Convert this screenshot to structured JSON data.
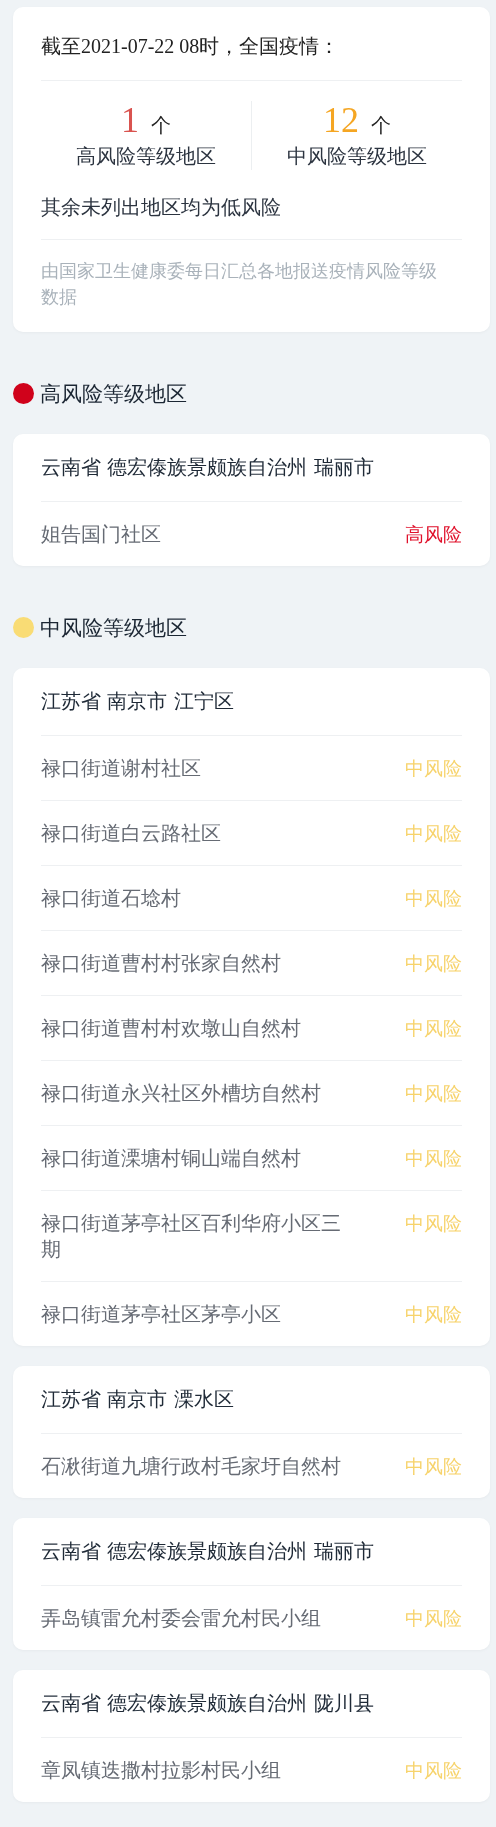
{
  "summary": {
    "title": "截至2021-07-22 08时，全国疫情：",
    "stats": [
      {
        "count": "1",
        "unit": "个",
        "label": "高风险等级地区",
        "kind": "high"
      },
      {
        "count": "12",
        "unit": "个",
        "label": "中风险等级地区",
        "kind": "medium"
      }
    ],
    "note": "其余未列出地区均为低风险",
    "source": "由国家卫生健康委每日汇总各地报送疫情风险等级数据"
  },
  "sections": [
    {
      "title": "高风险等级地区",
      "color": "#d0021b",
      "groups": [
        {
          "region": "云南省 德宏傣族景颇族自治州 瑞丽市",
          "items": [
            {
              "name": "姐告国门社区",
              "kind": "high",
              "risk_label": "高风险"
            }
          ]
        }
      ]
    },
    {
      "title": "中风险等级地区",
      "color": "#f9dc75",
      "groups": [
        {
          "region": "江苏省 南京市 江宁区",
          "items": [
            {
              "name": "禄口街道谢村社区",
              "kind": "medium",
              "risk_label": "中风险"
            },
            {
              "name": "禄口街道白云路社区",
              "kind": "medium",
              "risk_label": "中风险"
            },
            {
              "name": "禄口街道石埝村",
              "kind": "medium",
              "risk_label": "中风险"
            },
            {
              "name": "禄口街道曹村村张家自然村",
              "kind": "medium",
              "risk_label": "中风险"
            },
            {
              "name": "禄口街道曹村村欢墩山自然村",
              "kind": "medium",
              "risk_label": "中风险"
            },
            {
              "name": "禄口街道永兴社区外槽坊自然村",
              "kind": "medium",
              "risk_label": "中风险"
            },
            {
              "name": "禄口街道溧塘村铜山端自然村",
              "kind": "medium",
              "risk_label": "中风险"
            },
            {
              "name": "禄口街道茅亭社区百利华府小区三期",
              "kind": "medium",
              "risk_label": "中风险"
            },
            {
              "name": "禄口街道茅亭社区茅亭小区",
              "kind": "medium",
              "risk_label": "中风险"
            }
          ]
        },
        {
          "region": "江苏省 南京市 溧水区",
          "items": [
            {
              "name": "石湫街道九塘行政村毛家圩自然村",
              "kind": "medium",
              "risk_label": "中风险"
            }
          ]
        },
        {
          "region": "云南省 德宏傣族景颇族自治州 瑞丽市",
          "items": [
            {
              "name": "弄岛镇雷允村委会雷允村民小组",
              "kind": "medium",
              "risk_label": "中风险"
            }
          ]
        },
        {
          "region": "云南省 德宏傣族景颇族自治州 陇川县",
          "items": [
            {
              "name": "章凤镇迭撒村拉影村民小组",
              "kind": "medium",
              "risk_label": "中风险"
            }
          ]
        }
      ]
    }
  ]
}
